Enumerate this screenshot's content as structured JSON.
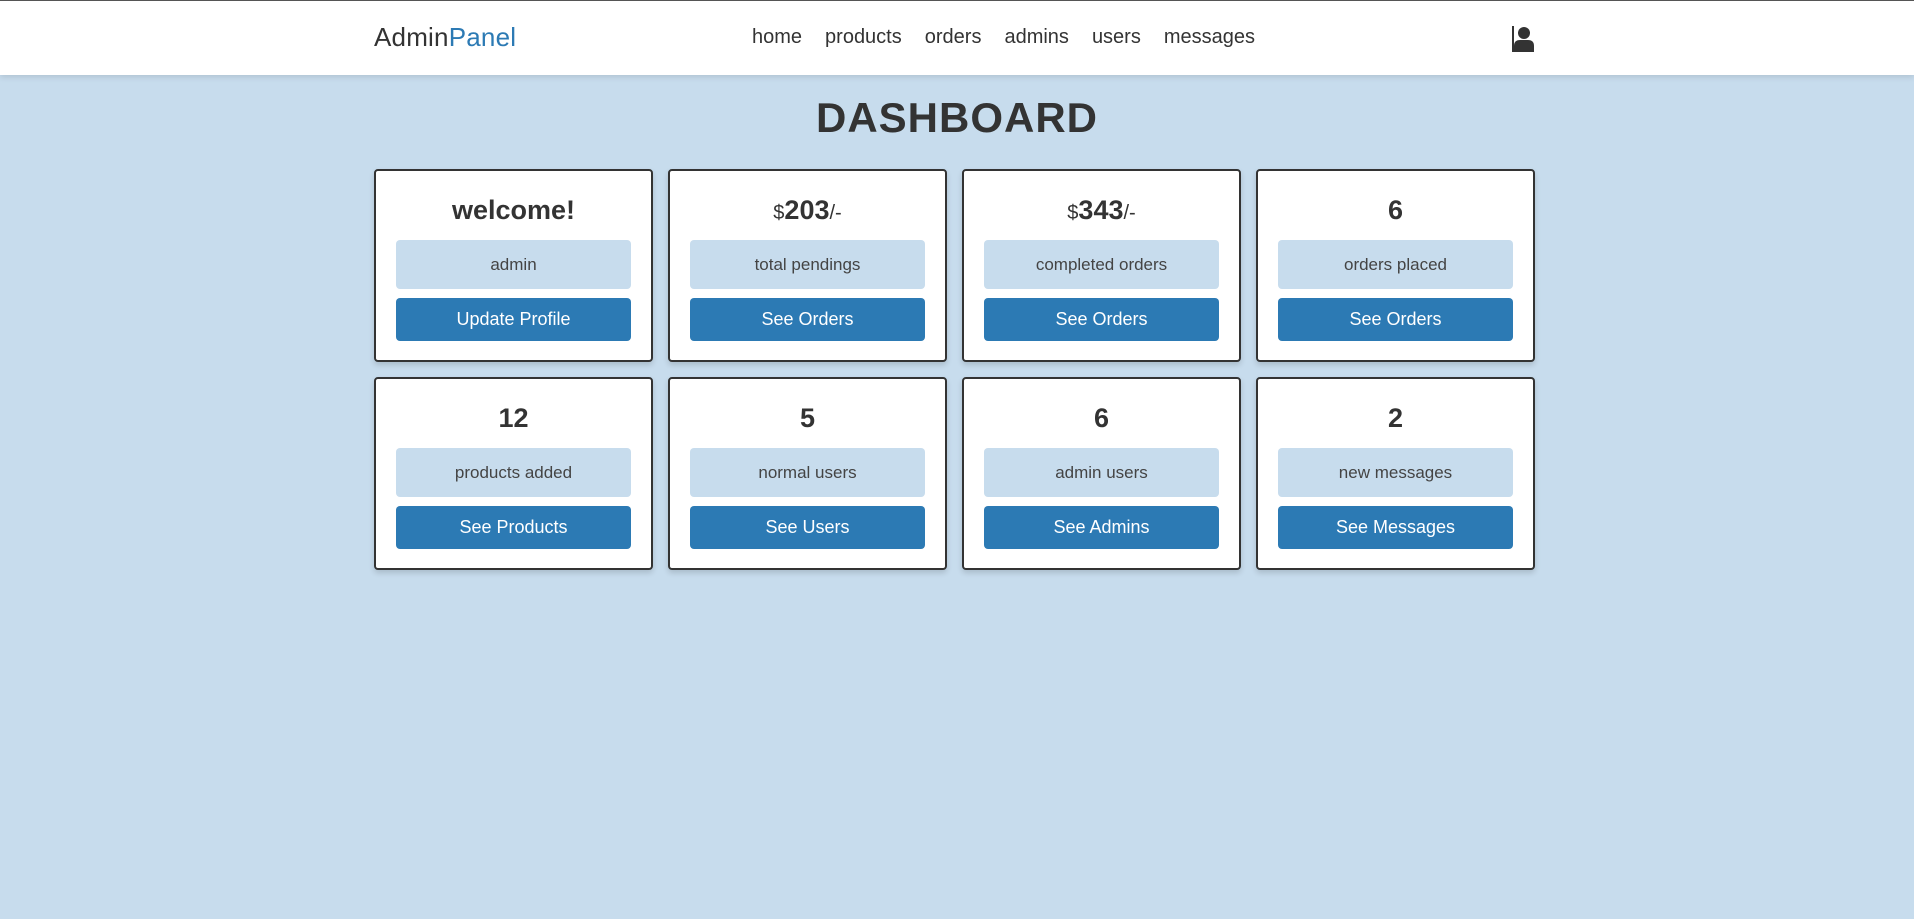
{
  "header": {
    "logo_main": "Admin",
    "logo_accent": "Panel",
    "nav": [
      "home",
      "products",
      "orders",
      "admins",
      "users",
      "messages"
    ],
    "user_icon": "user-icon"
  },
  "page_title": "DASHBOARD",
  "colors": {
    "background": "#c7dced",
    "accent": "#2c7ab4",
    "card_bg": "#ffffff",
    "text": "#333333"
  },
  "cards": [
    {
      "prefix": "",
      "value": "welcome!",
      "suffix": "",
      "label": "admin",
      "button": "Update Profile"
    },
    {
      "prefix": "$",
      "value": "203",
      "suffix": "/-",
      "label": "total pendings",
      "button": "See Orders"
    },
    {
      "prefix": "$",
      "value": "343",
      "suffix": "/-",
      "label": "completed orders",
      "button": "See Orders"
    },
    {
      "prefix": "",
      "value": "6",
      "suffix": "",
      "label": "orders placed",
      "button": "See Orders"
    },
    {
      "prefix": "",
      "value": "12",
      "suffix": "",
      "label": "products added",
      "button": "See Products"
    },
    {
      "prefix": "",
      "value": "5",
      "suffix": "",
      "label": "normal users",
      "button": "See Users"
    },
    {
      "prefix": "",
      "value": "6",
      "suffix": "",
      "label": "admin users",
      "button": "See Admins"
    },
    {
      "prefix": "",
      "value": "2",
      "suffix": "",
      "label": "new messages",
      "button": "See Messages"
    }
  ]
}
